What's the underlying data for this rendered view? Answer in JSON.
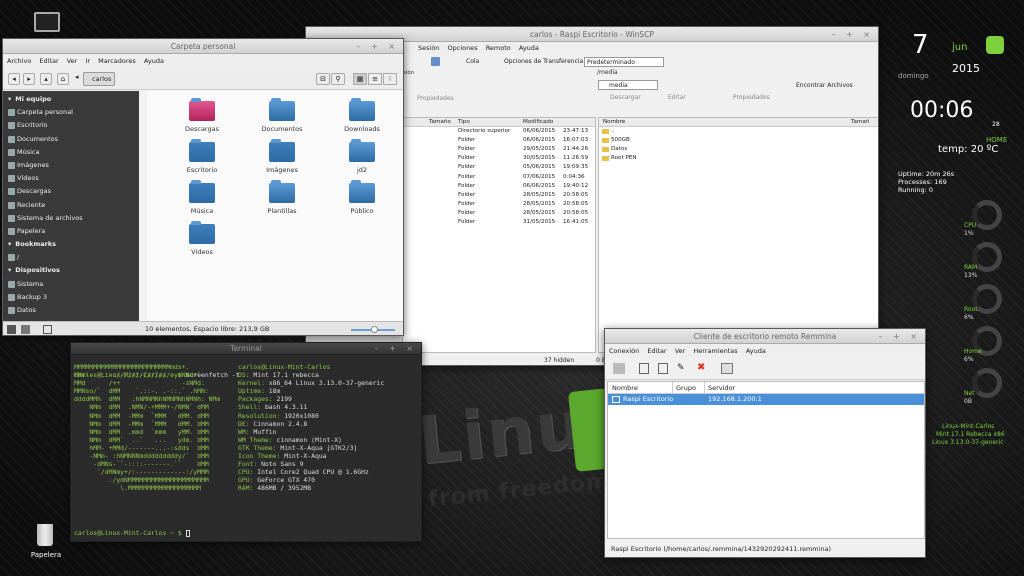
{
  "desktop": {
    "computer_label": "",
    "trash_label": "Papelera"
  },
  "nemo": {
    "title": "Carpeta personal",
    "menu": [
      "Archivo",
      "Editar",
      "Ver",
      "Ir",
      "Marcadores",
      "Ayuda"
    ],
    "path_button": "carlos",
    "sidebar": [
      {
        "label": "Mi equipo",
        "header": true
      },
      {
        "label": "Carpeta personal"
      },
      {
        "label": "Escritorio"
      },
      {
        "label": "Documentos"
      },
      {
        "label": "Música"
      },
      {
        "label": "Imágenes"
      },
      {
        "label": "Vídeos"
      },
      {
        "label": "Descargas"
      },
      {
        "label": "Reciente"
      },
      {
        "label": "Sistema de archivos"
      },
      {
        "label": "Papelera"
      },
      {
        "label": "Bookmarks",
        "header": true
      },
      {
        "label": "/"
      },
      {
        "label": "Dispositivos",
        "header": true
      },
      {
        "label": "Sistema"
      },
      {
        "label": "Backup 3"
      },
      {
        "label": "Datos"
      }
    ],
    "icons": [
      {
        "label": "Descargas",
        "color": "#d63a7a"
      },
      {
        "label": "Documentos",
        "color": "#5b9bd5"
      },
      {
        "label": "Downloads",
        "color": "#5b9bd5"
      },
      {
        "label": "Escritorio",
        "color": "#3e7fbd"
      },
      {
        "label": "Imágenes",
        "color": "#3e7fbd"
      },
      {
        "label": "jd2",
        "color": "#5b9bd5"
      },
      {
        "label": "Música",
        "color": "#3e7fbd"
      },
      {
        "label": "Plantillas",
        "color": "#5b9bd5"
      },
      {
        "label": "Público",
        "color": "#5b9bd5"
      },
      {
        "label": "Vídeos",
        "color": "#3e7fbd"
      }
    ],
    "status": "10 elementos, Espacio libre: 213,9 GB"
  },
  "winscp": {
    "title": "carlos - Raspi Escritorio - WinSCP",
    "menu": [
      "Sesión",
      "Opciones",
      "Remoto",
      "Ayuda"
    ],
    "toolbar": {
      "queue": "Cola",
      "transfer_label": "Opciones de Transferencia",
      "transfer_value": "Predeterminado"
    },
    "left": {
      "tab": "sión",
      "toolbar_props": "Propiedades",
      "headers": {
        "size": "Tamaño",
        "type": "Tipo",
        "modified": "Modificado"
      },
      "rows": [
        {
          "type": "Directorio superior",
          "mod": "06/06/2015",
          "time": "23:47:13"
        },
        {
          "type": "Folder",
          "mod": "06/06/2015",
          "time": "16:07:03"
        },
        {
          "type": "Folder",
          "mod": "29/05/2015",
          "time": "21:44:26"
        },
        {
          "type": "Folder",
          "mod": "30/05/2015",
          "time": "11:26:59"
        },
        {
          "type": "Folder",
          "mod": "05/06/2015",
          "time": "19:09:35"
        },
        {
          "type": "Folder",
          "mod": "07/06/2015",
          "time": "0:04:36"
        },
        {
          "type": "Folder",
          "mod": "06/06/2015",
          "time": "19:40:12"
        },
        {
          "type": "Folder",
          "mod": "28/05/2015",
          "time": "20:58:05"
        },
        {
          "type": "Folder",
          "mod": "28/05/2015",
          "time": "20:58:05"
        },
        {
          "type": "Folder",
          "mod": "28/05/2015",
          "time": "20:58:05"
        },
        {
          "type": "Folder",
          "mod": "31/05/2015",
          "time": "16:41:05"
        }
      ],
      "status_hidden": "37 hidden"
    },
    "right": {
      "path": "/media",
      "dir": "media",
      "find": "Encontrar Archivos",
      "download": "Descargar",
      "edit": "Editar",
      "props": "Propiedades",
      "headers": {
        "name": "Nombre",
        "size": "Tamañ"
      },
      "rows": [
        "..",
        "500GB",
        "Datos",
        "Root PEN"
      ],
      "status": "0 B o"
    }
  },
  "terminal": {
    "title": "Terminal",
    "prompt": "carlos@Linux-Mint-Carlos ~ $",
    "command": "screenfetch -t",
    "logo": [
      "MMMMMMMMMMMMMMMMMMMMMMMMMmds+.",
      "MMm----::-://////////////oymNMd+`",
      "MMd      /++                -sNMd:",
      "MMNso/`  dMM    `.::-. .-::.` .hMN:",
      "ddddMMh  dMM   :hNMNMNhNMNMNhNMNh: NMm",
      "    NMm  dMM  .NMN/-+MMM+-/NMN` dMM",
      "    NMm  dMM  -MMm  `MMM   dMM. dMM",
      "    NMm  dMM  -MMm  `MMM   dMM. dMM",
      "    NMm  dMM  .mmd  `mmm   yMM. dMM",
      "    NMm  dMM`  ..`   ...   ydm. dMM",
      "    hMM- +MMd/-------...-:sdds  dMM",
      "    -NMm- :hNMNNNmdddddddddy/`  dMM",
      "     -dMNs-``-::::-------.``    dMM",
      "      `/dMNmy+/:-------------:/yMMM",
      "         ./ydNMMMMMMMMMMMMMMMMMMMMM",
      "            \\.MMMMMMMMMMMMMMMMMMM"
    ],
    "info_user": "carlos@Linux-Mint-Carlos",
    "info": [
      {
        "k": "OS:",
        "v": "Mint 17.1 rebecca"
      },
      {
        "k": "Kernel:",
        "v": "x86_64 Linux 3.13.0-37-generic"
      },
      {
        "k": "Uptime:",
        "v": "18m"
      },
      {
        "k": "Packages:",
        "v": "2199"
      },
      {
        "k": "Shell:",
        "v": "bash 4.3.11"
      },
      {
        "k": "Resolution:",
        "v": "1920x1080"
      },
      {
        "k": "DE:",
        "v": "Cinnamon 2.4.8"
      },
      {
        "k": "WM:",
        "v": "Muffin"
      },
      {
        "k": "WM Theme:",
        "v": "cinnamon (Mint-X)"
      },
      {
        "k": "GTK Theme:",
        "v": "Mint-X-Aqua [GTK2/3]"
      },
      {
        "k": "Icon Theme:",
        "v": "Mint-X-Aqua"
      },
      {
        "k": "Font:",
        "v": "Noto Sans 9"
      },
      {
        "k": "CPU:",
        "v": "Intel Core2 Quad CPU @ 1.6GHz"
      },
      {
        "k": "GPU:",
        "v": "GeForce GTX 470"
      },
      {
        "k": "RAM:",
        "v": "486MB / 3952MB"
      }
    ]
  },
  "remmina": {
    "title": "Cliente de escritorio remoto Remmina",
    "menu": [
      "Conexión",
      "Editar",
      "Ver",
      "Herramientas",
      "Ayuda"
    ],
    "headers": {
      "name": "Nombre",
      "group": "Grupo",
      "server": "Servidor"
    },
    "rows": [
      {
        "name": "Raspi Escritorio",
        "group": "",
        "server": "192.168.1.200:1"
      }
    ],
    "status": "Raspi Escritorio (/home/carlos/.remmina/1432920292411.remmina)"
  },
  "conky": {
    "day": "7",
    "month": "jun",
    "weekday": "domingo",
    "year": "2015",
    "time": "00:06",
    "seconds": "28",
    "home_label": "HOME",
    "temp": "temp: 20 ºC",
    "uptime": "Uptime: 20m 26s",
    "processes": "Processes: 169",
    "running": "Running: 0",
    "meters": [
      {
        "label": "CPU",
        "value": "1%"
      },
      {
        "label": "RAM",
        "value": "13%"
      },
      {
        "label": "Root",
        "value": "6%"
      },
      {
        "label": "Home",
        "value": "6%"
      },
      {
        "label": "Net",
        "value": "0B"
      }
    ],
    "footer": [
      "Linux-Mint-Carlos",
      "Mint 17.1 Rebecca x86",
      "Linux 3.13.0-37-generic"
    ]
  },
  "wallpaper": {
    "big_text": "Linux",
    "sub_text": "from freedom"
  }
}
